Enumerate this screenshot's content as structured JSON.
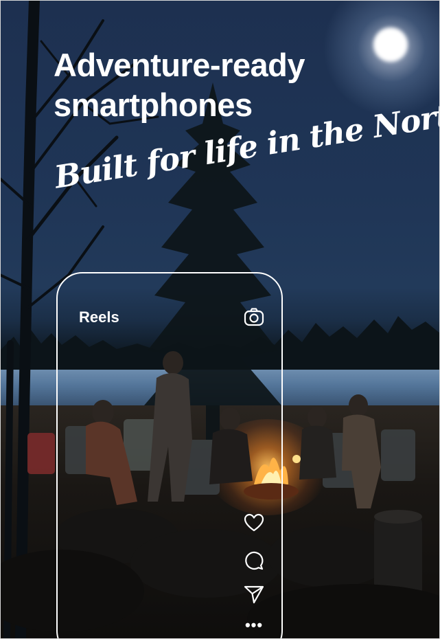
{
  "ad": {
    "headline": "Adventure-ready smartphones",
    "tagline": "Built for life in the North"
  },
  "phone": {
    "section_label": "Reels",
    "top_icon": "camera-icon",
    "side_icons": [
      "heart-icon",
      "comment-icon",
      "share-icon",
      "more-icon"
    ],
    "more_glyph": "•••"
  },
  "colors": {
    "sky": "#1f3556",
    "text": "#ffffff",
    "fire": "#ffa64d"
  }
}
